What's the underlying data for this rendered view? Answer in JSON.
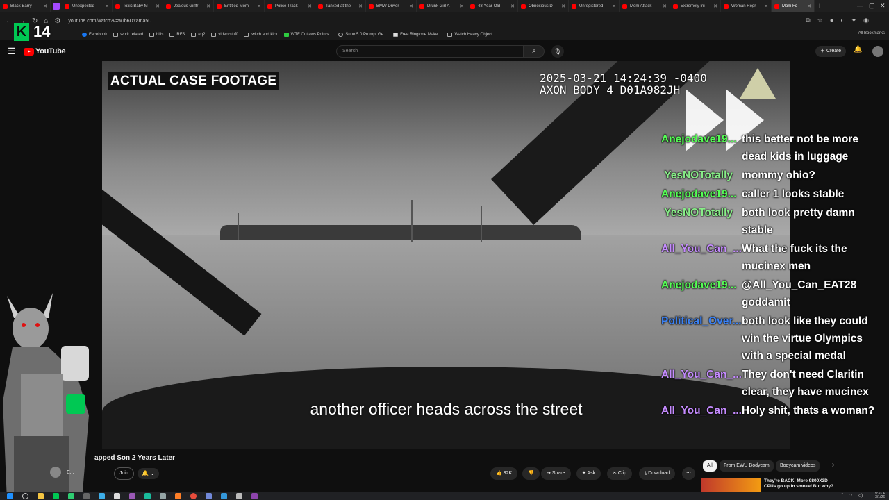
{
  "browser": {
    "tabs": [
      {
        "title": "Black Barry - "
      },
      {
        "title": "Unexpected "
      },
      {
        "title": "Toxic Baby M"
      },
      {
        "title": "Jealous Girlfr"
      },
      {
        "title": "Entitled Mom"
      },
      {
        "title": "Police Track"
      },
      {
        "title": "Tanked at the"
      },
      {
        "title": "BMW Driver"
      },
      {
        "title": "Drunk Girl A"
      },
      {
        "title": "48-Year-Old"
      },
      {
        "title": "Obnoxious D"
      },
      {
        "title": "Unregistered"
      },
      {
        "title": "Mom Attack"
      },
      {
        "title": "Extremely Ini"
      },
      {
        "title": "Woman Regr"
      },
      {
        "title": "Mom Fo"
      }
    ],
    "url": "youtube.com/watch?v=wJb6DYama5U",
    "bookmarks": [
      "Facebook",
      "work related",
      "bills",
      "RFS",
      "eq2",
      "video stuff",
      "twitch and kick",
      "WTF Outlaws Points...",
      "Suno 5.0 Prompt Ge...",
      "Free Ringtone Make...",
      "Watch Heavy Object..."
    ],
    "all_bookmarks": "All Bookmarks"
  },
  "overlay": {
    "k_letter": "K",
    "k_number": "14"
  },
  "youtube": {
    "logo_text": "YouTube",
    "search_placeholder": "Search",
    "create_label": "Create"
  },
  "video": {
    "case_label": "ACTUAL CASE FOOTAGE",
    "timestamp": "2025-03-21 14:24:39 -0400",
    "device": "AXON BODY 4 D01A982JH",
    "subtitle": "another officer heads across the street"
  },
  "chat": [
    {
      "user": "Anejodave19...",
      "color": "#55ff55",
      "text": "this better not be more dead kids in luggage"
    },
    {
      "user": "YesNOTotally",
      "color": "#88ee88",
      "text": "mommy ohio?"
    },
    {
      "user": "Anejodave19...",
      "color": "#55ff55",
      "text": "caller 1 looks stable"
    },
    {
      "user": "YesNOTotally",
      "color": "#88ee88",
      "text": "both look pretty damn stable"
    },
    {
      "user": "All_You_Can_...",
      "color": "#c58bff",
      "text": "What the fuck its the mucinex men"
    },
    {
      "user": "Anejodave19...",
      "color": "#55ff55",
      "text": "@All_You_Can_EAT28 goddamit"
    },
    {
      "user": "Political_Over...",
      "color": "#3b82f6",
      "text": "both look like they could win the virtue Olympics with a special medal"
    },
    {
      "user": "All_You_Can_...",
      "color": "#c58bff",
      "text": "They don't need Claritin clear, they have mucinex"
    },
    {
      "user": "All_You_Can_...",
      "color": "#c58bff",
      "text": "Holy shit, thats a woman?"
    }
  ],
  "below": {
    "video_title": "apped Son 2 Years Later",
    "channel_name": "E...",
    "join_label": "Join",
    "likes": "32K",
    "share_label": "Share",
    "ask_label": "Ask",
    "clip_label": "Clip",
    "download_label": "Download",
    "chips": [
      "All",
      "From EWU Bodycam",
      "Bodycam videos"
    ],
    "rec_title": "They're BACK! More 9800X3D CPUs go up in smoke! But why?"
  },
  "system": {
    "time": "9:33 A",
    "date": "3/1/26"
  },
  "icons": [
    "back-icon",
    "forward-icon",
    "reload-icon",
    "home-icon",
    "menu-icon",
    "search-icon",
    "mic-icon",
    "bell-icon",
    "like-icon",
    "dislike-icon",
    "share-icon",
    "sparkle-icon",
    "scissors-icon",
    "download-icon",
    "more-icon",
    "chevron-right-icon"
  ]
}
